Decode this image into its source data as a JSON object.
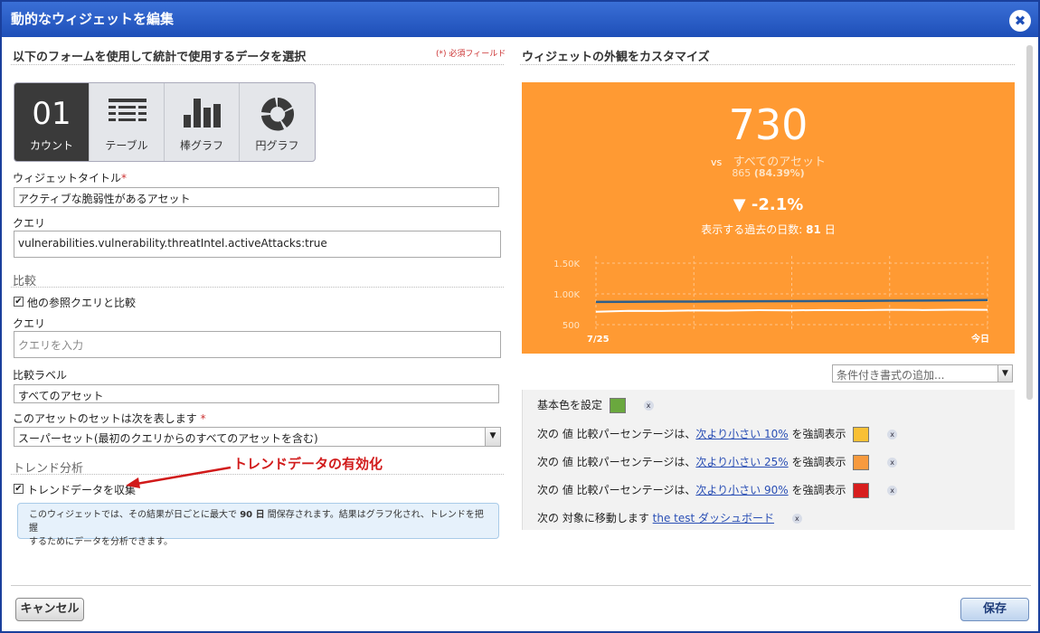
{
  "window": {
    "title": "動的なウィジェットを編集",
    "close": "✖"
  },
  "left": {
    "section_title": "以下のフォームを使用して統計で使用するデータを選択",
    "required_note": "(*) 必須フィールド",
    "widget_types": [
      {
        "label": "カウント",
        "icon": "count-01",
        "value": "01",
        "active": true
      },
      {
        "label": "テーブル",
        "icon": "table-icon"
      },
      {
        "label": "棒グラフ",
        "icon": "bar-chart-icon"
      },
      {
        "label": "円グラフ",
        "icon": "pie-chart-icon"
      }
    ],
    "widget_title_label": "ウィジェットタイトル",
    "widget_title_value": "アクティブな脆弱性があるアセット",
    "query_label": "クエリ",
    "query_value": "vulnerabilities.vulnerability.threatIntel.activeAttacks:true",
    "compare_heading": "比較",
    "compare_checkbox_label": "他の参照クエリと比較",
    "compare_query_label": "クエリ",
    "compare_query_placeholder": "クエリを入力",
    "compare_label_label": "比較ラベル",
    "compare_label_value": "すべてのアセット",
    "asset_set_label": "このアセットのセットは次を表します",
    "asset_set_value": "スーパーセット(最初のクエリからのすべてのアセットを含む)",
    "trend_heading": "トレンド分析",
    "trend_checkbox_label": "トレンドデータを収集",
    "annotation": "トレンドデータの有効化",
    "info_pre": "このウィジェットでは、その結果が日ごとに最大で",
    "info_days": "90 日",
    "info_post": "間保存されます。結果はグラフ化され、トレンドを把握",
    "info_line2": "するためにデータを分析できます。"
  },
  "right": {
    "section_title": "ウィジェットの外観をカスタマイズ",
    "preview": {
      "count": "730",
      "vs_label": "vs",
      "vs_text": "すべてのアセット",
      "total": "865",
      "percent": "(84.39%)",
      "delta": "-2.1%",
      "delta_icon": "down-triangle",
      "days_label": "表示する過去の日数:",
      "days_value": "81",
      "days_unit": "日",
      "bg_color": "#ff9a33"
    },
    "conditional_placeholder": "条件付き書式の追加...",
    "rules": [
      {
        "text": "基本色を設定",
        "color": "#6aa83e"
      },
      {
        "pre": "次の 値 比較パーセンテージは、",
        "link": "次より小さい 10%",
        "post": "を強調表示",
        "color": "#f9c035"
      },
      {
        "pre": "次の 値 比較パーセンテージは、",
        "link": "次より小さい 25%",
        "post": "を強調表示",
        "color": "#f79a3e"
      },
      {
        "pre": "次の 値 比較パーセンテージは、",
        "link": "次より小さい 90%",
        "post": "を強調表示",
        "color": "#d81e1e"
      },
      {
        "pre": "次の 対象に移動します",
        "link": "the test ダッシュボード"
      }
    ]
  },
  "chart_data": {
    "type": "line",
    "x_start_label": "7/25",
    "x_end_label": "今日",
    "y_ticks": [
      "1.50K",
      "1.00K",
      "500"
    ],
    "ylim": [
      400,
      1600
    ],
    "series": [
      {
        "values": [
          870,
          872,
          875,
          875,
          878,
          880,
          882,
          884,
          886,
          890,
          892,
          895,
          900
        ],
        "color": "#2f5f8a"
      },
      {
        "values": [
          710,
          725,
          722,
          730,
          728,
          735,
          732,
          738,
          735,
          740,
          738,
          742,
          740
        ],
        "color": "#ffffff"
      }
    ]
  },
  "footer": {
    "cancel": "キャンセル",
    "save": "保存"
  }
}
